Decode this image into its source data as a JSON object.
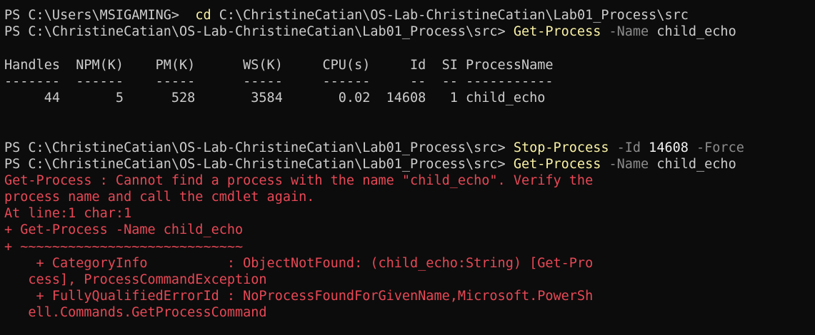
{
  "window": {
    "background": "#0c0c0c",
    "foreground": "#cccccc",
    "command_color": "#f9f1a5",
    "parameter_color": "#8c8c8c",
    "error_color": "#e74856"
  },
  "line1": {
    "prompt": "PS C:\\Users\\MSIGAMING>  ",
    "cmd": "cd",
    "arg": " C:\\ChristineCatian\\OS-Lab-ChristineCatian\\Lab01_Process\\src"
  },
  "line2": {
    "prompt": "PS C:\\ChristineCatian\\OS-Lab-ChristineCatian\\Lab01_Process\\src> ",
    "cmd": "Get-Process",
    "param": " -Name",
    "arg": " child_echo"
  },
  "table": {
    "header": "Handles  NPM(K)    PM(K)      WS(K)     CPU(s)     Id  SI ProcessName",
    "separator": "-------  ------    -----      -----     ------     --  -- -----------",
    "row": "     44       5      528       3584       0.02  14608   1 child_echo"
  },
  "line3": {
    "prompt": "PS C:\\ChristineCatian\\OS-Lab-ChristineCatian\\Lab01_Process\\src> ",
    "cmd": "Stop-Process",
    "param1": " -Id",
    "num": " 14608",
    "param2": " -Force"
  },
  "line4": {
    "prompt": "PS C:\\ChristineCatian\\OS-Lab-ChristineCatian\\Lab01_Process\\src> ",
    "cmd": "Get-Process",
    "param": " -Name",
    "arg": " child_echo"
  },
  "error": {
    "lines": [
      "Get-Process : Cannot find a process with the name \"child_echo\". Verify the",
      "process name and call the cmdlet again.",
      "At line:1 char:1",
      "+ Get-Process -Name child_echo",
      "+ ~~~~~~~~~~~~~~~~~~~~~~~~~~~~",
      "    + CategoryInfo          : ObjectNotFound: (child_echo:String) [Get-Pro",
      "   cess], ProcessCommandException",
      "    + FullyQualifiedErrorId : NoProcessFoundForGivenName,Microsoft.PowerSh",
      "   ell.Commands.GetProcessCommand"
    ]
  }
}
